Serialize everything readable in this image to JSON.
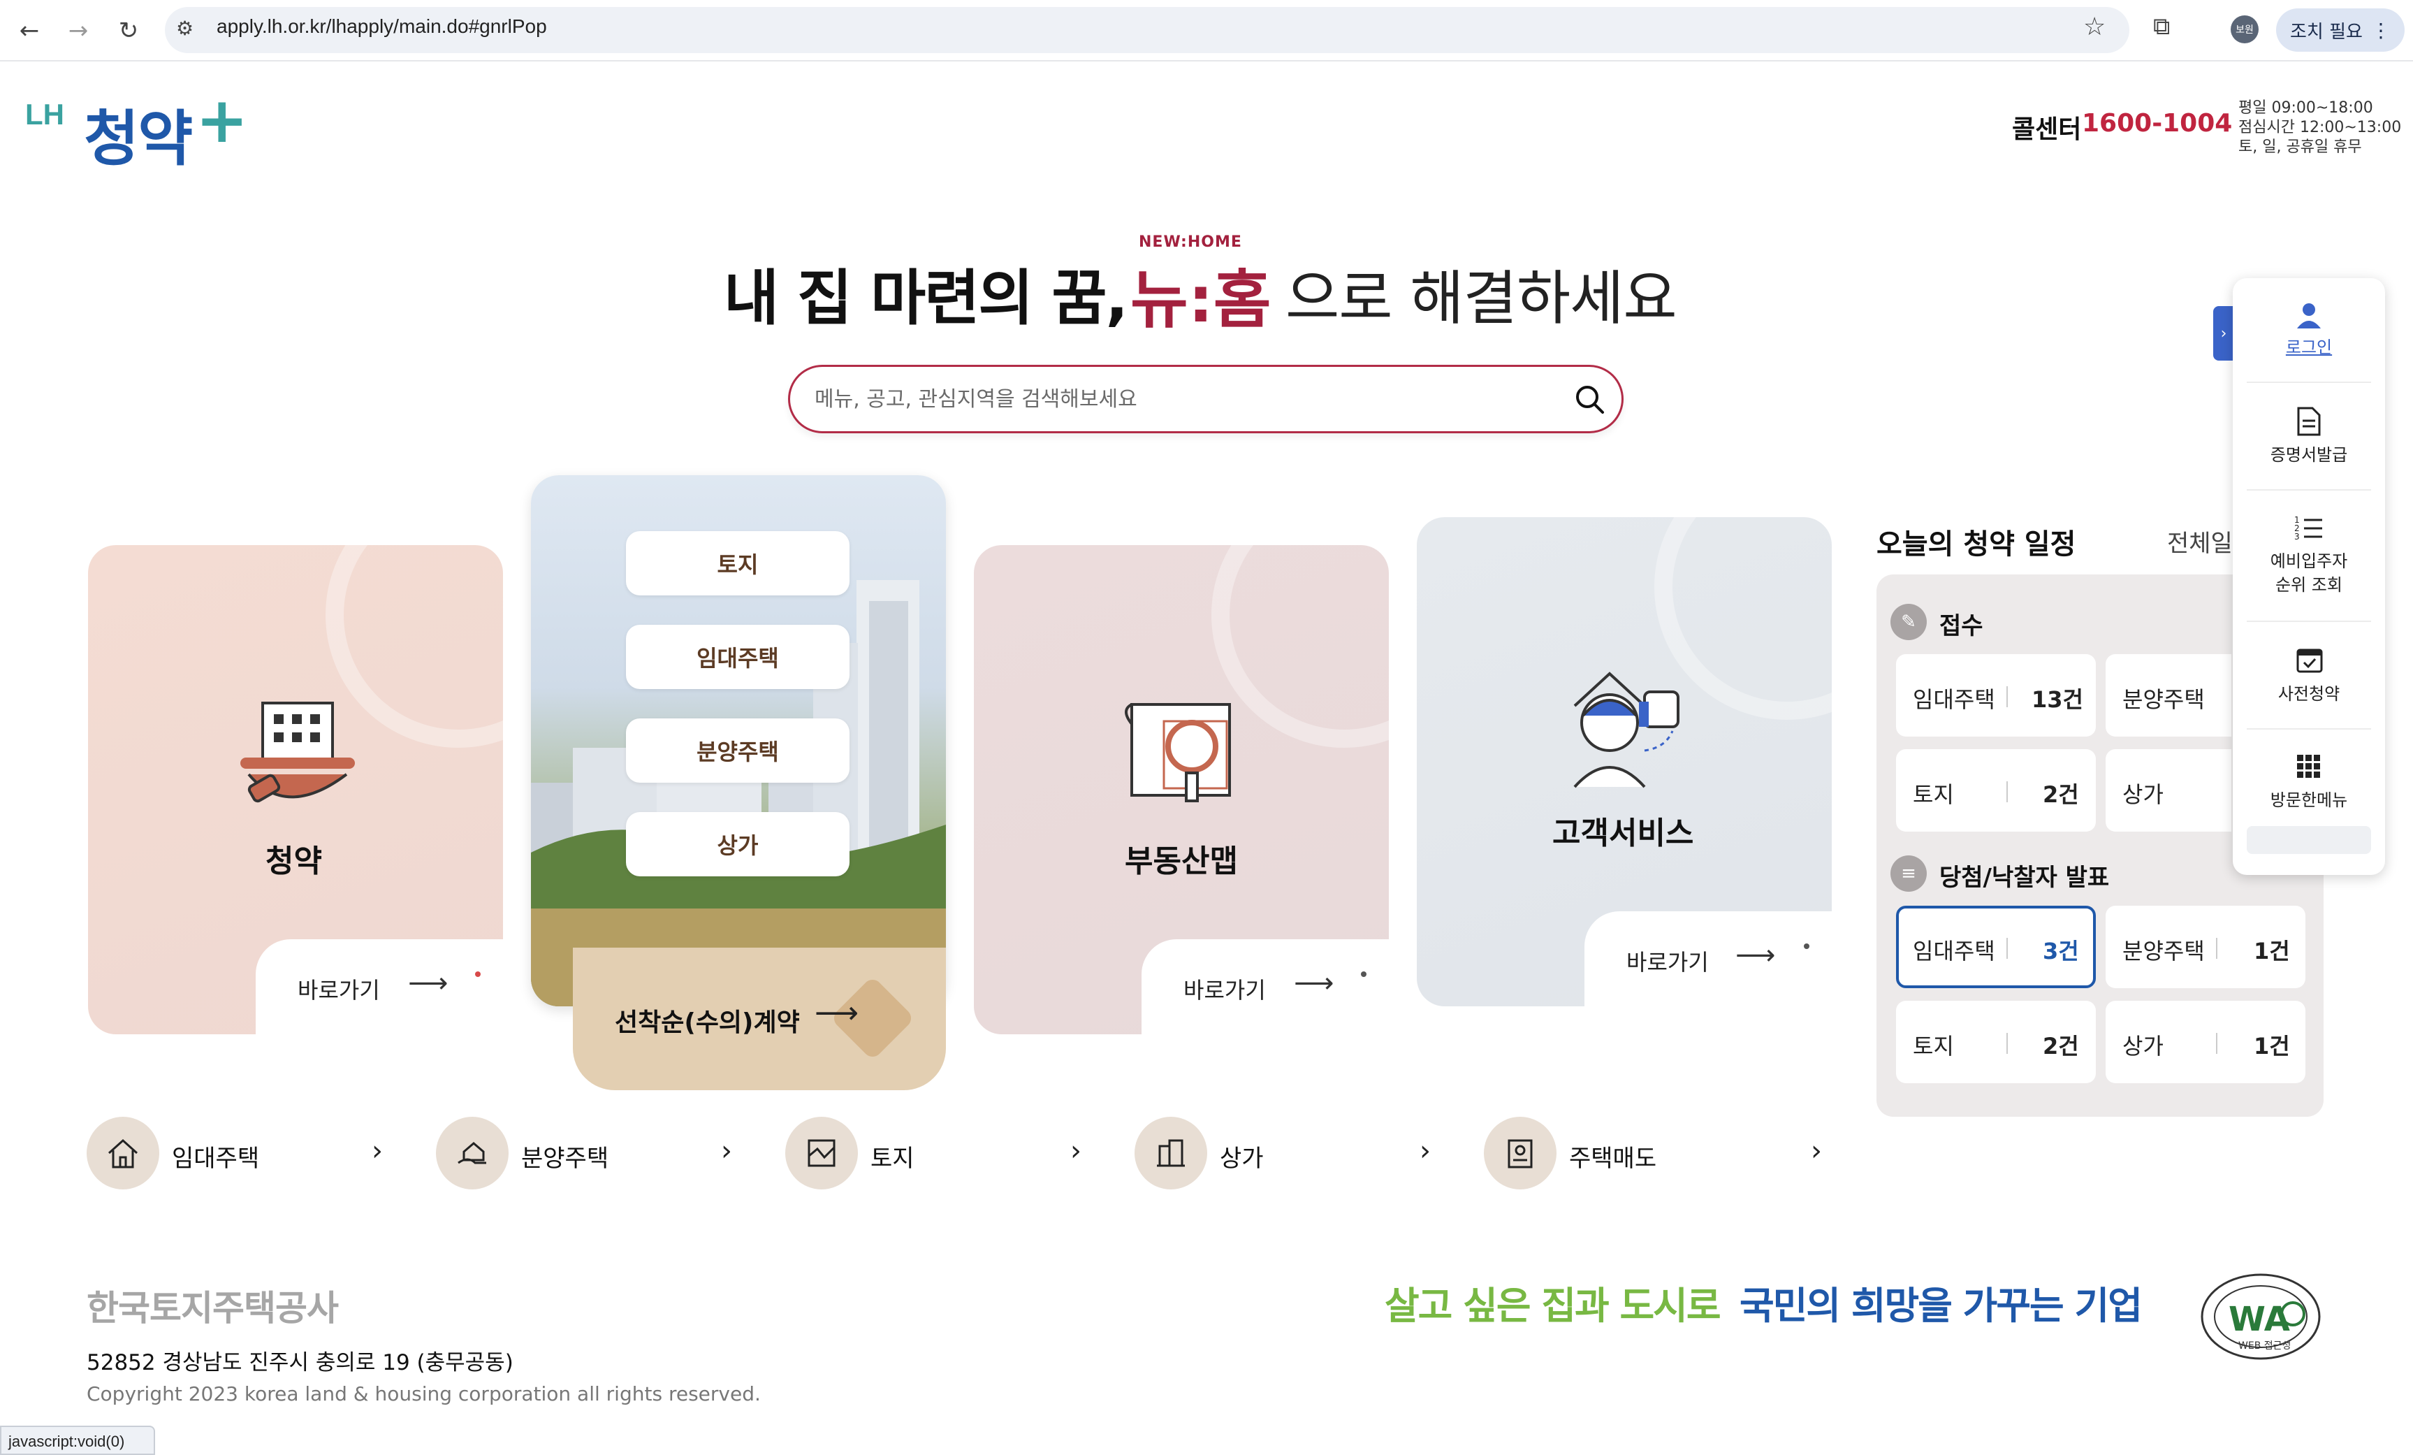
{
  "browser": {
    "url": "apply.lh.or.kr/lhapply/main.do#gnrlPop",
    "profile_label": "보원",
    "action_label": "조치 필요"
  },
  "header": {
    "logo_lh": "LH",
    "logo_main": "청약",
    "logo_plus": "+",
    "callcenter_label": "콜센터",
    "callcenter_number": "1600-1004",
    "hours": [
      "평일 09:00~18:00",
      "점심시간 12:00~13:00",
      "토, 일, 공휴일 휴무"
    ]
  },
  "hero": {
    "headline_a": "내 집 마련의 꿈,",
    "logo_small": "NEW:HOME",
    "logo": "뉴:홈",
    "headline_b": "으로 해결하세요",
    "search_placeholder": "메뉴, 공고, 관심지역을 검색해보세요"
  },
  "cards": {
    "cheongyak": {
      "title": "청약",
      "goto": "바로가기"
    },
    "menu_items": [
      "토지",
      "임대주택",
      "분양주택",
      "상가"
    ],
    "first_come": "선착순(수의)계약",
    "realty_map": {
      "title": "부동산맵",
      "goto": "바로가기"
    },
    "customer": {
      "title": "고객서비스",
      "goto": "바로가기"
    }
  },
  "schedule": {
    "title": "오늘의 청약 일정",
    "view_all": "전체일",
    "sections": [
      {
        "head": "접수",
        "cells": [
          {
            "label": "임대주택",
            "count": "13건"
          },
          {
            "label": "분양주택",
            "count": ""
          },
          {
            "label": "토지",
            "count": "2건"
          },
          {
            "label": "상가",
            "count": ""
          }
        ]
      },
      {
        "head": "당첨/낙찰자 발표",
        "cells": [
          {
            "label": "임대주택",
            "count": "3건"
          },
          {
            "label": "분양주택",
            "count": "1건"
          },
          {
            "label": "토지",
            "count": "2건"
          },
          {
            "label": "상가",
            "count": "1건"
          }
        ]
      }
    ]
  },
  "quick_menu": {
    "items": [
      "로그인",
      "증명서발급",
      "예비입주자",
      "순위 조회",
      "사전청약",
      "방문한메뉴"
    ]
  },
  "categories": [
    "임대주택",
    "분양주택",
    "토지",
    "상가",
    "주택매도"
  ],
  "footer": {
    "org_name": "한국토지주택공사",
    "address": "52852 경상남도 진주시 충의로 19 (충무공동)",
    "copyright": "Copyright 2023 korea land & housing corporation all rights reserved.",
    "slogan_a": "살고 싶은 집과 도시로",
    "slogan_b": "국민의 희망을 가꾸는 기업",
    "badge_text": "WA",
    "badge_sub": "WEB 접근성"
  },
  "status_bar": "javascript:void(0)",
  "colors": {
    "brand_blue": "#1f58a9",
    "brand_teal": "#3aa2a0",
    "brand_red": "#a3213e",
    "accent_green": "#78b843"
  }
}
